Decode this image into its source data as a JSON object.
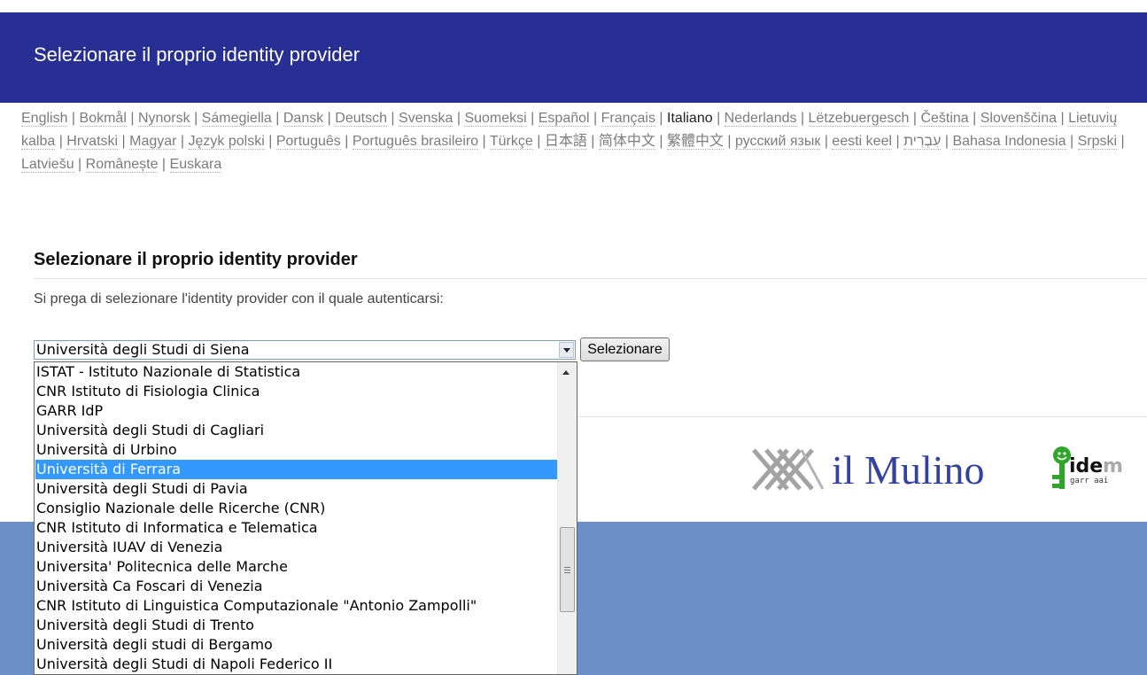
{
  "header": {
    "title": "Selezionare il proprio identity provider"
  },
  "languages": [
    {
      "label": "English",
      "current": false
    },
    {
      "label": "Bokmål",
      "current": false
    },
    {
      "label": "Nynorsk",
      "current": false
    },
    {
      "label": "Sámegiella",
      "current": false
    },
    {
      "label": "Dansk",
      "current": false
    },
    {
      "label": "Deutsch",
      "current": false
    },
    {
      "label": "Svenska",
      "current": false
    },
    {
      "label": "Suomeksi",
      "current": false
    },
    {
      "label": "Español",
      "current": false
    },
    {
      "label": "Français",
      "current": false
    },
    {
      "label": "Italiano",
      "current": true
    },
    {
      "label": "Nederlands",
      "current": false
    },
    {
      "label": "Lëtzebuergesch",
      "current": false
    },
    {
      "label": "Čeština",
      "current": false
    },
    {
      "label": "Slovenščina",
      "current": false
    },
    {
      "label": "Lietuvių kalba",
      "current": false
    },
    {
      "label": "Hrvatski",
      "current": false
    },
    {
      "label": "Magyar",
      "current": false
    },
    {
      "label": "Język polski",
      "current": false
    },
    {
      "label": "Português",
      "current": false
    },
    {
      "label": "Português brasileiro",
      "current": false
    },
    {
      "label": "Türkçe",
      "current": false
    },
    {
      "label": "日本語",
      "current": false
    },
    {
      "label": "简体中文",
      "current": false
    },
    {
      "label": "繁體中文",
      "current": false
    },
    {
      "label": "русский язык",
      "current": false
    },
    {
      "label": "eesti keel",
      "current": false
    },
    {
      "label": "עִבְרִית",
      "current": false
    },
    {
      "label": "Bahasa Indonesia",
      "current": false
    },
    {
      "label": "Srpski",
      "current": false
    },
    {
      "label": "Latviešu",
      "current": false
    },
    {
      "label": "Românește",
      "current": false
    },
    {
      "label": "Euskara",
      "current": false
    }
  ],
  "main": {
    "heading": "Selezionare il proprio identity provider",
    "instruction": "Si prega di selezionare l'identity provider con il quale autenticarsi:",
    "select_value": "Università degli Studi di Siena",
    "button_label": "Selezionare"
  },
  "dropdown": {
    "options": [
      "ISTAT - Istituto Nazionale di Statistica",
      "CNR Istituto di Fisiologia Clinica",
      "GARR IdP",
      "Università degli Studi di Cagliari",
      "Università di Urbino",
      "Università di Ferrara",
      "Università degli Studi di Pavia",
      "Consiglio Nazionale delle Ricerche (CNR)",
      "CNR Istituto di Informatica e Telematica",
      "Università IUAV di Venezia",
      "Universita' Politecnica delle Marche",
      "Università Ca Foscari di Venezia",
      "CNR Istituto di Linguistica Computazionale \"Antonio Zampolli\"",
      "Università degli Studi di Trento",
      "Università degli studi di Bergamo",
      "Università degli Studi di Napoli Federico II"
    ],
    "highlighted": "Università di Ferrara"
  },
  "logos": {
    "mulino": "il Mulino",
    "idem_main": "ide",
    "idem_sub": "garr aai"
  },
  "colors": {
    "header_bg": "#272e94",
    "footer_bg": "#6b8ec6",
    "highlight": "#3399ff",
    "mulino_blue": "#3342a0",
    "idem_green": "#2fa52a"
  }
}
